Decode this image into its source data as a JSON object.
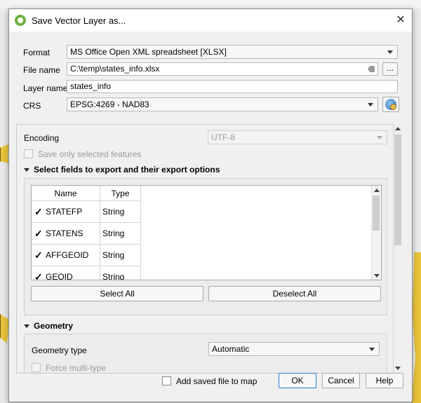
{
  "window": {
    "title": "Save Vector Layer as...",
    "close": "✕"
  },
  "form": {
    "format_label": "Format",
    "format_value": "MS Office Open XML spreadsheet [XLSX]",
    "filename_label": "File name",
    "filename_value": "C:\\temp\\states_info.xlsx",
    "browse_label": "...",
    "layername_label": "Layer name",
    "layername_value": "states_info",
    "crs_label": "CRS",
    "crs_value": "EPSG:4269 - NAD83"
  },
  "options": {
    "encoding_label": "Encoding",
    "encoding_value": "UTF-8",
    "save_selected_label": "Save only selected features",
    "fields_section_title": "Select fields to export and their export options",
    "table": {
      "headers": [
        "Name",
        "Type"
      ],
      "rows": [
        {
          "checked": "✓",
          "name": "STATEFP",
          "type": "String"
        },
        {
          "checked": "✓",
          "name": "STATENS",
          "type": "String"
        },
        {
          "checked": "✓",
          "name": "AFFGEOID",
          "type": "String"
        },
        {
          "checked": "✓",
          "name": "GEOID",
          "type": "String"
        }
      ]
    },
    "select_all_label": "Select All",
    "deselect_all_label": "Deselect All",
    "geometry_section_title": "Geometry",
    "geometry_type_label": "Geometry type",
    "geometry_type_value": "Automatic",
    "force_multi_label": "Force multi-type"
  },
  "footer": {
    "add_saved_label": "Add saved file to map",
    "ok_label": "OK",
    "cancel_label": "Cancel",
    "help_label": "Help"
  }
}
